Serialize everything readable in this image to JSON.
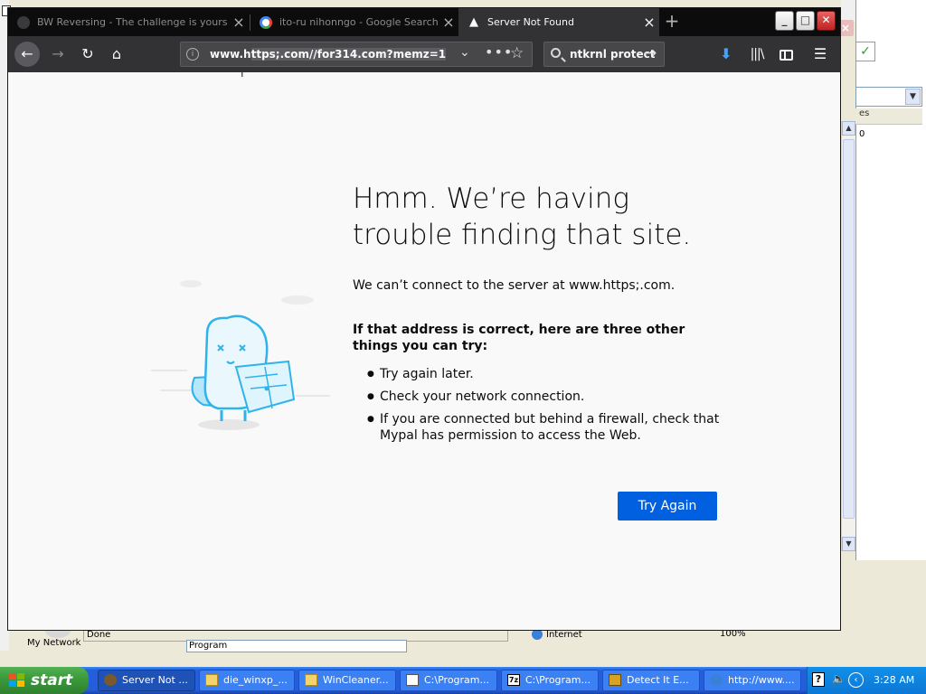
{
  "browser": {
    "tabs": [
      {
        "title": "BW Reversing - The challenge is yours",
        "active": false
      },
      {
        "title": "ito-ru nihonngo - Google Search",
        "active": false
      },
      {
        "title": "Server Not Found",
        "active": true
      }
    ],
    "url_prefix": "www.h",
    "url_highlight": "ttps;.com//for314.com?memz=1",
    "search_text": "ntkrnl protect"
  },
  "error_page": {
    "title": "Hmm. We’re having trouble finding that site.",
    "description": "We can’t connect to the server at www.https;.com.",
    "subtitle": "If that address is correct, here are three other things you can try:",
    "suggestions": [
      "Try again later.",
      "Check your network connection.",
      "If you are connected but behind a firewall, check that Mypal has permission to access the Web."
    ],
    "button_label": "Try Again"
  },
  "background_window": {
    "status_done": "Done",
    "status_zone": "Internet",
    "zoom": "100%",
    "program_field": "Program",
    "header_fragment": "es",
    "cell_fragment": "0",
    "desktop_icon_label": "My Network"
  },
  "taskbar": {
    "start_label": "start",
    "items": [
      "Server Not ...",
      "die_winxp_...",
      "WinCleaner...",
      "C:\\Program...",
      "C:\\Program...",
      "Detect It E...",
      "http://www...."
    ],
    "clock": "3:28 AM"
  },
  "colors": {
    "accent_button": "#0060df",
    "toolbar_dark": "#323234",
    "tabstrip": "#0c0c0d",
    "xp_taskbar": "#245edb",
    "xp_start": "#3c9b3c"
  }
}
